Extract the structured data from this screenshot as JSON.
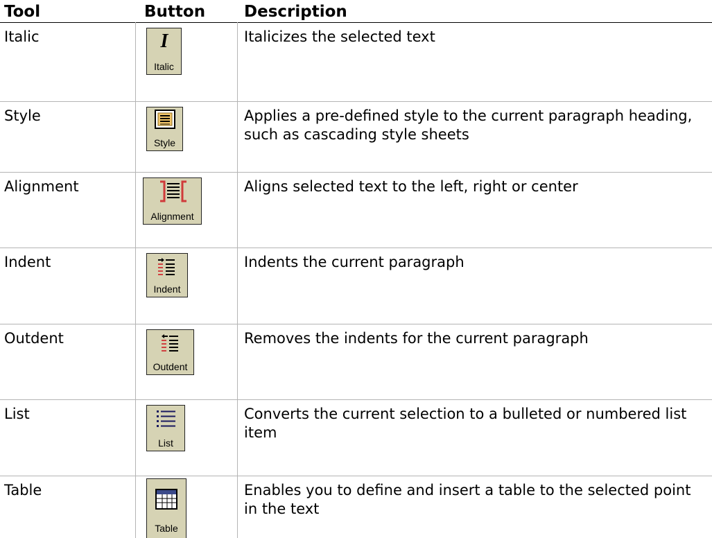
{
  "header": {
    "tool": "Tool",
    "button": "Button",
    "description": "Description"
  },
  "rows": [
    {
      "tool": "Italic",
      "button_label": "Italic",
      "icon": "italic-icon",
      "description": "Italicizes the selected text"
    },
    {
      "tool": "Style",
      "button_label": "Style",
      "icon": "style-icon",
      "description": "Applies a pre-defined style to the current paragraph heading, such as cascading style sheets"
    },
    {
      "tool": "Alignment",
      "button_label": "Alignment",
      "icon": "alignment-icon",
      "description": "Aligns selected text to the left, right or center"
    },
    {
      "tool": "Indent",
      "button_label": "Indent",
      "icon": "indent-icon",
      "description": "Indents the current paragraph"
    },
    {
      "tool": "Outdent",
      "button_label": "Outdent",
      "icon": "outdent-icon",
      "description": "Removes the indents for the current paragraph"
    },
    {
      "tool": "List",
      "button_label": "List",
      "icon": "list-icon",
      "description": "Converts the current selection to a bulleted or numbered list item"
    },
    {
      "tool": "Table",
      "button_label": "Table",
      "icon": "table-icon",
      "description": "Enables you to define and insert a table to the selected point in the text"
    }
  ]
}
